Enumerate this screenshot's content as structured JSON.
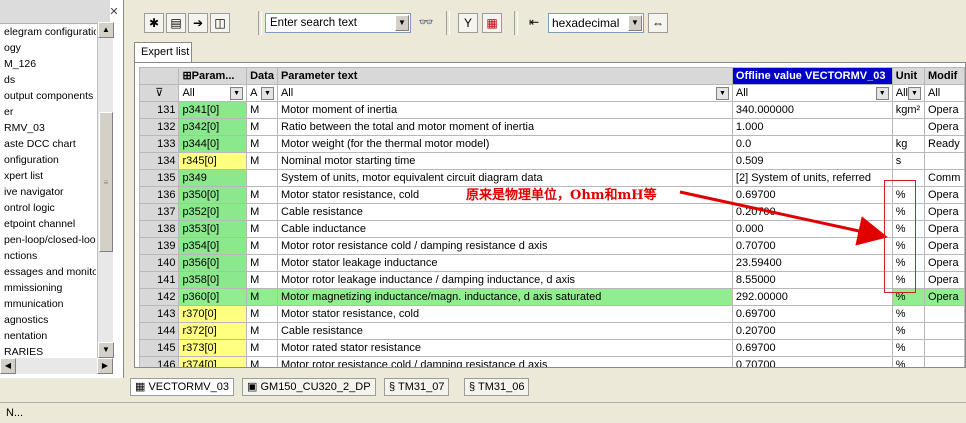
{
  "tree": {
    "items": [
      "elegram configuratio",
      "ogy",
      "M_126",
      "ds",
      "output components",
      "er",
      "RMV_03",
      "aste DCC chart",
      "onfiguration",
      "xpert list",
      "ive navigator",
      "ontrol logic",
      "etpoint channel",
      "pen-loop/closed-loo",
      "nctions",
      "essages and monito",
      "mmissioning",
      "mmunication",
      "agnostics",
      "nentation",
      "RARIES"
    ]
  },
  "toolbar": {
    "search_placeholder": "Enter search text",
    "format_value": "hexadecimal"
  },
  "tab_label": "Expert list",
  "table": {
    "headers": {
      "param": "Param...",
      "data": "Data",
      "text": "Parameter text",
      "offline": "Offline value VECTORMV_03",
      "unit": "Unit",
      "modif": "Modif"
    },
    "filters": {
      "param": "All",
      "data": "A",
      "text": "All",
      "offline": "All",
      "unit": "All",
      "modif": "All"
    },
    "rows": [
      {
        "n": "131",
        "p": "p341[0]",
        "c": "green",
        "d": "M",
        "t": "Motor moment of inertia",
        "v": "340.000000",
        "u": "kgm²",
        "m": "Opera"
      },
      {
        "n": "132",
        "p": "p342[0]",
        "c": "green",
        "d": "M",
        "t": "Ratio between the total and motor moment of inertia",
        "v": "1.000",
        "u": "",
        "m": "Opera"
      },
      {
        "n": "133",
        "p": "p344[0]",
        "c": "green",
        "d": "M",
        "t": "Motor weight (for the thermal motor model)",
        "v": "0.0",
        "u": "kg",
        "m": "Ready"
      },
      {
        "n": "134",
        "p": "r345[0]",
        "c": "yellow",
        "d": "M",
        "t": "Nominal motor starting time",
        "v": "0.509",
        "u": "s",
        "m": ""
      },
      {
        "n": "135",
        "p": "p349",
        "c": "green",
        "d": "",
        "t": "System of units, motor equivalent circuit diagram data",
        "v": "[2] System of units, referred",
        "u": "",
        "m": "Comm"
      },
      {
        "n": "136",
        "p": "p350[0]",
        "c": "green",
        "d": "M",
        "t": "Motor stator resistance, cold",
        "v": "0.69700",
        "u": "%",
        "m": "Opera"
      },
      {
        "n": "137",
        "p": "p352[0]",
        "c": "green",
        "d": "M",
        "t": "Cable resistance",
        "v": "0.20700",
        "u": "%",
        "m": "Opera"
      },
      {
        "n": "138",
        "p": "p353[0]",
        "c": "green",
        "d": "M",
        "t": "Cable inductance",
        "v": "0.000",
        "u": "%",
        "m": "Opera"
      },
      {
        "n": "139",
        "p": "p354[0]",
        "c": "green",
        "d": "M",
        "t": "Motor rotor resistance cold / damping resistance d axis",
        "v": "0.70700",
        "u": "%",
        "m": "Opera"
      },
      {
        "n": "140",
        "p": "p356[0]",
        "c": "green",
        "d": "M",
        "t": "Motor stator leakage inductance",
        "v": "23.59400",
        "u": "%",
        "m": "Opera"
      },
      {
        "n": "141",
        "p": "p358[0]",
        "c": "green",
        "d": "M",
        "t": "Motor rotor leakage inductance / damping inductance, d axis",
        "v": "8.55000",
        "u": "%",
        "m": "Opera"
      },
      {
        "n": "142",
        "p": "p360[0]",
        "c": "green",
        "d": "M",
        "t": "Motor magnetizing inductance/magn. inductance, d axis saturated",
        "v": "292.00000",
        "u": "%",
        "m": "Opera",
        "sel": true
      },
      {
        "n": "143",
        "p": "r370[0]",
        "c": "yellow",
        "d": "M",
        "t": "Motor stator resistance, cold",
        "v": "0.69700",
        "u": "%",
        "m": ""
      },
      {
        "n": "144",
        "p": "r372[0]",
        "c": "yellow",
        "d": "M",
        "t": "Cable resistance",
        "v": "0.20700",
        "u": "%",
        "m": ""
      },
      {
        "n": "145",
        "p": "r373[0]",
        "c": "yellow",
        "d": "M",
        "t": "Motor rated stator resistance",
        "v": "0.69700",
        "u": "%",
        "m": ""
      },
      {
        "n": "146",
        "p": "r374[0]",
        "c": "yellow",
        "d": "M",
        "t": "Motor rotor resistance cold / damping resistance d axis",
        "v": "0.70700",
        "u": "%",
        "m": ""
      }
    ]
  },
  "annotation": "原来是物理单位，Ohm和mH等",
  "bottom_tabs": [
    "VECTORMV_03",
    "GM150_CU320_2_DP",
    "TM31_07",
    "TM31_06"
  ],
  "status": "N..."
}
